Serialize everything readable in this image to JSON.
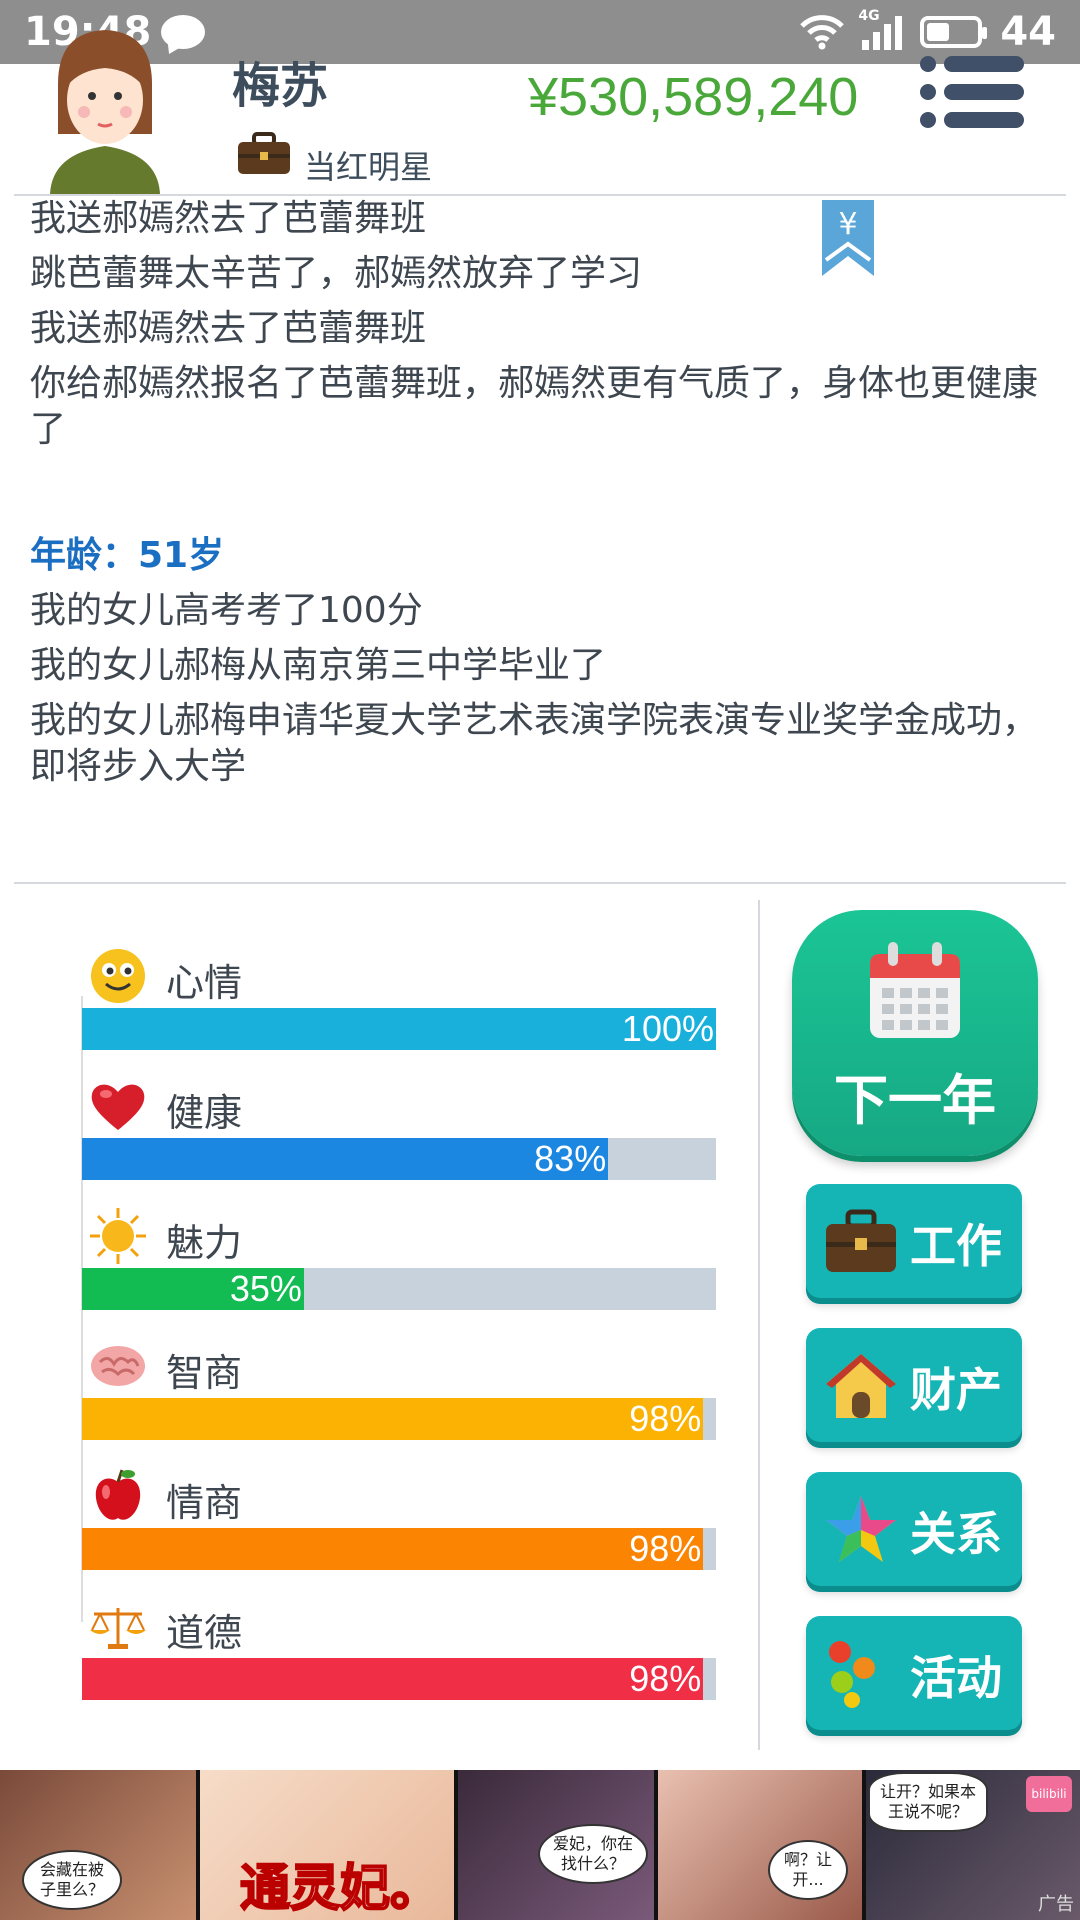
{
  "status_bar": {
    "time": "19:48",
    "network": "4G",
    "battery": "44"
  },
  "player": {
    "name": "梅苏",
    "job": "当红明星",
    "money": "¥530,589,240"
  },
  "log": [
    {
      "text": "我送郝嫣然去了芭蕾舞班",
      "type": "event"
    },
    {
      "text": "跳芭蕾舞太辛苦了，郝嫣然放弃了学习",
      "type": "event"
    },
    {
      "text": "我送郝嫣然去了芭蕾舞班",
      "type": "event"
    },
    {
      "text": "你给郝嫣然报名了芭蕾舞班，郝嫣然更有气质了，身体也更健康了",
      "type": "event"
    },
    {
      "text": "年龄：51岁",
      "type": "age"
    },
    {
      "text": "我的女儿高考考了100分",
      "type": "event"
    },
    {
      "text": "我的女儿郝梅从南京第三中学毕业了",
      "type": "event"
    },
    {
      "text": "我的女儿郝梅申请华夏大学艺术表演学院表演专业奖学金成功，即将步入大学",
      "type": "event"
    }
  ],
  "bookmark": {
    "symbol": "¥"
  },
  "stats": [
    {
      "label": "心情",
      "value": 100,
      "display": "100%",
      "color": "#1ab0dc",
      "icon": "smiley-icon"
    },
    {
      "label": "健康",
      "value": 83,
      "display": "83%",
      "color": "#1b87e0",
      "icon": "heart-icon"
    },
    {
      "label": "魅力",
      "value": 35,
      "display": "35%",
      "color": "#12bc52",
      "icon": "sun-icon"
    },
    {
      "label": "智商",
      "value": 98,
      "display": "98%",
      "color": "#fbb202",
      "icon": "brain-icon"
    },
    {
      "label": "情商",
      "value": 98,
      "display": "98%",
      "color": "#fb8402",
      "icon": "apple-icon"
    },
    {
      "label": "道德",
      "value": 98,
      "display": "98%",
      "color": "#f02e46",
      "icon": "scales-icon"
    }
  ],
  "actions": {
    "next_year": "下一年",
    "work": "工作",
    "property": "财产",
    "relations": "关系",
    "activities": "活动"
  },
  "ad": {
    "bubbles": [
      "会藏在被子里么？",
      "爱妃，你在找什么？",
      "啊？让开...",
      "让开？如果本王说不呢？"
    ],
    "logo": "通灵妃。",
    "tag": "广告",
    "brand": "bilibili"
  }
}
